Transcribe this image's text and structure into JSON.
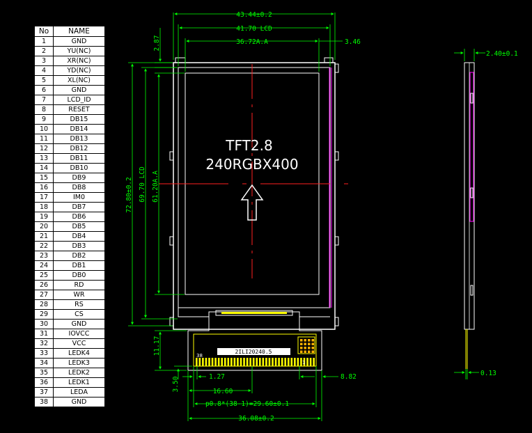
{
  "table": {
    "headers": {
      "no": "No",
      "name": "NAME"
    },
    "pins": [
      [
        "1",
        "GND"
      ],
      [
        "2",
        "YU(NC)"
      ],
      [
        "3",
        "XR(NC)"
      ],
      [
        "4",
        "YD(NC)"
      ],
      [
        "5",
        "XL(NC)"
      ],
      [
        "6",
        "GND"
      ],
      [
        "7",
        "LCD_ID"
      ],
      [
        "8",
        "RESET"
      ],
      [
        "9",
        "DB15"
      ],
      [
        "10",
        "DB14"
      ],
      [
        "11",
        "DB13"
      ],
      [
        "12",
        "DB12"
      ],
      [
        "13",
        "DB11"
      ],
      [
        "14",
        "DB10"
      ],
      [
        "15",
        "DB9"
      ],
      [
        "16",
        "DB8"
      ],
      [
        "17",
        "IM0"
      ],
      [
        "18",
        "DB7"
      ],
      [
        "19",
        "DB6"
      ],
      [
        "20",
        "DB5"
      ],
      [
        "21",
        "DB4"
      ],
      [
        "22",
        "DB3"
      ],
      [
        "23",
        "DB2"
      ],
      [
        "24",
        "DB1"
      ],
      [
        "25",
        "DB0"
      ],
      [
        "26",
        "RD"
      ],
      [
        "27",
        "WR"
      ],
      [
        "28",
        "RS"
      ],
      [
        "29",
        "CS"
      ],
      [
        "30",
        "GND"
      ],
      [
        "31",
        "IOVCC"
      ],
      [
        "32",
        "VCC"
      ],
      [
        "33",
        "LEDK4"
      ],
      [
        "34",
        "LEDK3"
      ],
      [
        "35",
        "LEDK2"
      ],
      [
        "36",
        "LEDK1"
      ],
      [
        "37",
        "LEDA"
      ],
      [
        "38",
        "GND"
      ]
    ]
  },
  "screen_label": {
    "line1": "TFT2.8",
    "line2": "240RGBX400"
  },
  "dimensions": {
    "overall_width": "43.44±0.2",
    "lcd_width": "41.70 LCD",
    "aa_width": "36.72A.A",
    "side_3_46": "3.46",
    "top_2_87": "2.87",
    "overall_height": "72.80±0.2",
    "lcd_height": "69.70 LCD",
    "aa_height": "61.20A.A",
    "thickness": "2.40±0.1",
    "fpc_thickness": "0.13",
    "fpc_11_17": "11.17",
    "fpc_1_27": "1.27",
    "fpc_3_50": "3.50",
    "fpc_16_60": "16.60",
    "fpc_8_82": "8.82",
    "pitch": "p0.8*(38-1)=29.60±0.1",
    "fpc_width": "36.08±0.2"
  },
  "fpc": {
    "part_label": "2ILI20240.5",
    "pin_38": "38",
    "pin_1": "1"
  },
  "colors": {
    "outline": "#ffffff",
    "dimension": "#00ff00",
    "centerline": "#ff0000",
    "fpc": "#ffff00",
    "flex_side": "#ff00ff"
  }
}
